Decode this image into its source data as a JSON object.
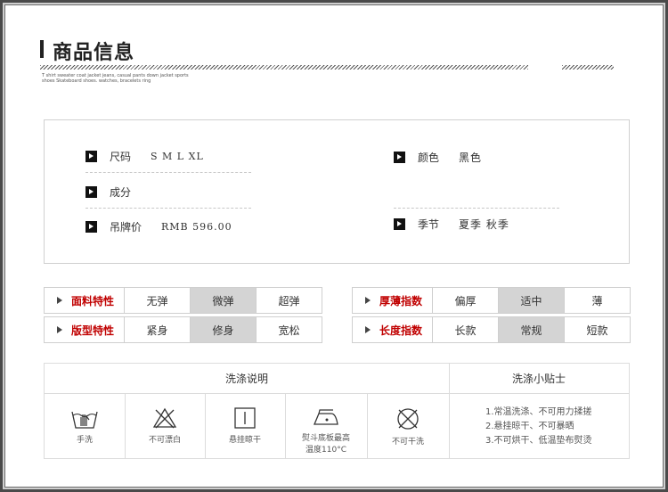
{
  "header": {
    "title": "商品信息",
    "subtext_line1": "T shirt sweater coat jacket jeans, casual pants down jacket  sports",
    "subtext_line2": "shoes  Skateboard shoes. watches, bracelets ring"
  },
  "spec": {
    "size_label": "尺码",
    "size_value": "S M L XL",
    "material_label": "成分",
    "material_value": "",
    "price_label": "吊牌价",
    "price_value": "RMB 596.00",
    "color_label": "颜色",
    "color_value": "黑色",
    "season_label": "季节",
    "season_value": "夏季 秋季"
  },
  "attributes": {
    "elasticity": {
      "label": "面料特性",
      "options": [
        "无弹",
        "微弹",
        "超弹"
      ],
      "selected": 1
    },
    "fit": {
      "label": "版型特性",
      "options": [
        "紧身",
        "修身",
        "宽松"
      ],
      "selected": 1
    },
    "thickness": {
      "label": "厚薄指数",
      "options": [
        "偏厚",
        "适中",
        "薄"
      ],
      "selected": 1
    },
    "length": {
      "label": "长度指数",
      "options": [
        "长款",
        "常规",
        "短款"
      ],
      "selected": 1
    }
  },
  "wash": {
    "title": "洗涤说明",
    "tips_title": "洗涤小贴士",
    "icons": [
      {
        "icon": "hand-wash-icon",
        "label": "手洗"
      },
      {
        "icon": "no-bleach-icon",
        "label": "不可漂白"
      },
      {
        "icon": "hang-dry-icon",
        "label": "悬挂晾干"
      },
      {
        "icon": "iron-low-icon",
        "label": "熨斗底板最高",
        "label2": "温度110°C"
      },
      {
        "icon": "no-dry-clean-icon",
        "label": "不可干洗"
      }
    ],
    "tips": [
      "1.常温洗涤、不可用力揉搓",
      "2.悬挂晾干、不可暴晒",
      "3.不可烘干、低温垫布熨烫"
    ]
  }
}
